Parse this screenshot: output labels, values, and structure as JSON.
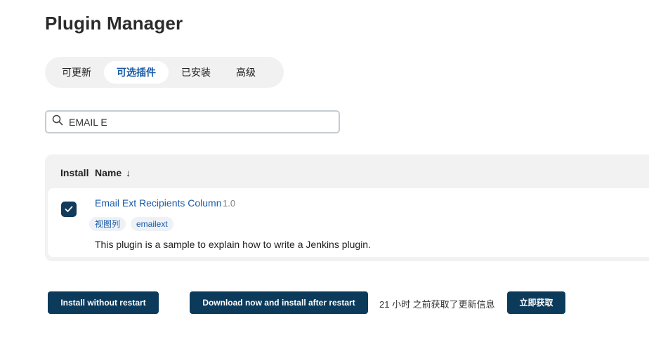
{
  "page": {
    "title": "Plugin Manager"
  },
  "tabs": [
    {
      "label": "可更新",
      "active": false
    },
    {
      "label": "可选插件",
      "active": true
    },
    {
      "label": "已安装",
      "active": false
    },
    {
      "label": "高级",
      "active": false
    }
  ],
  "search": {
    "value": "EMAIL E",
    "icon": "search-icon"
  },
  "table": {
    "columns": {
      "install": "Install",
      "name": "Name",
      "sort_indicator": "↓"
    },
    "rows": [
      {
        "checked": true,
        "name": "Email Ext Recipients Column",
        "version": "1.0",
        "tags": [
          "视图列",
          "emailext"
        ],
        "description": "This plugin is a sample to explain how to write a Jenkins plugin."
      }
    ]
  },
  "actions": {
    "install_without_restart": "Install without restart",
    "download_and_install_after_restart": "Download now and install after restart",
    "update_info": "21 小时 之前获取了更新信息",
    "fetch_now": "立即获取"
  },
  "colors": {
    "primary_button": "#0c3a5b",
    "link": "#1a5aa8",
    "tab_bar_bg": "#f1f1f1",
    "table_bg": "#f2f2f2"
  }
}
